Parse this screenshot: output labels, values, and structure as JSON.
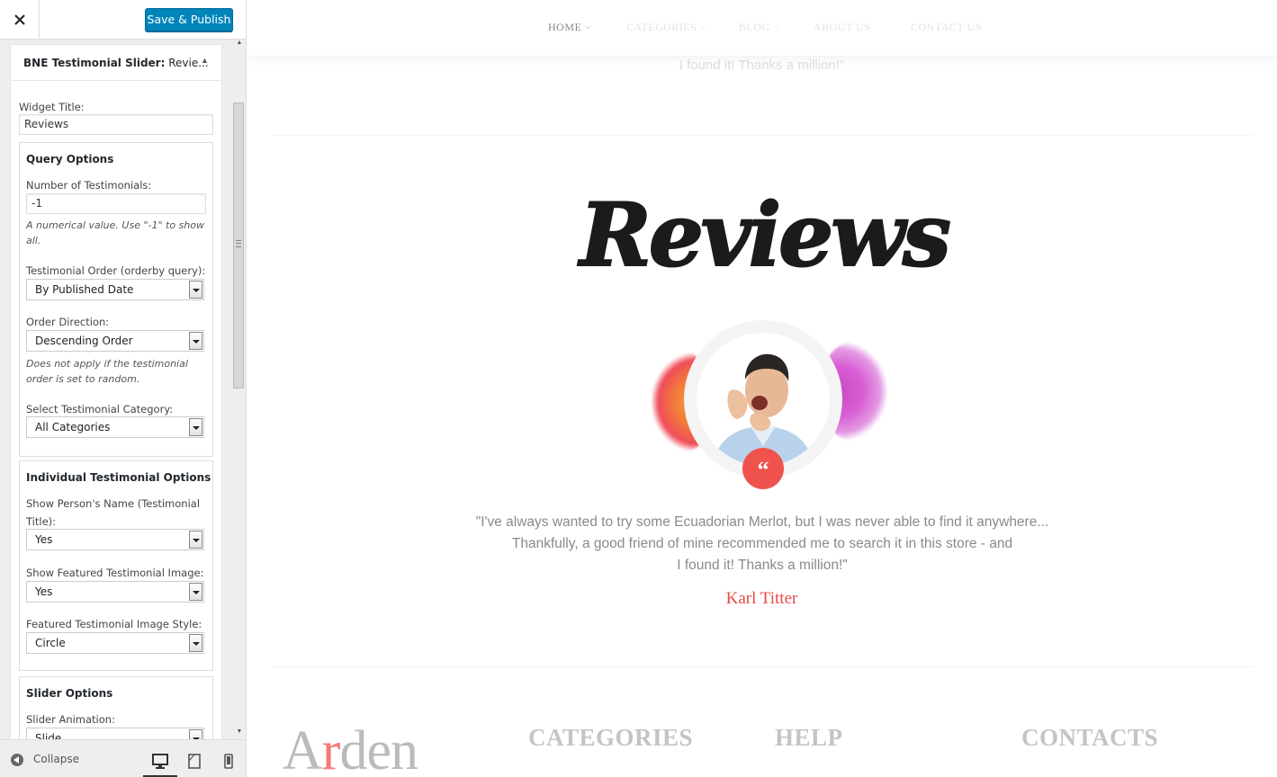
{
  "header": {
    "close_label": "Close",
    "save_label": "Save & Publish",
    "accent": "#0085ba"
  },
  "widget": {
    "title_bold": "BNE Testimonial Slider:",
    "title_instance": " Revie...",
    "widget_title_label": "Widget Title:",
    "widget_title_value": "Reviews",
    "query": {
      "title": "Query Options",
      "count_label": "Number of Testimonials:",
      "count_value": "-1",
      "count_desc": "A numerical value. Use \"-1\" to show all.",
      "order_label": "Testimonial Order (orderby query):",
      "order_value": "By Published Date",
      "direction_label": "Order Direction:",
      "direction_value": "Descending Order",
      "direction_desc": "Does not apply if the testimonial order is set to random.",
      "category_label": "Select Testimonial Category:",
      "category_value": "All Categories"
    },
    "individual": {
      "title": "Individual Testimonial Options",
      "name_label_1": "Show Person's Name (Testimonial",
      "name_label_2": "Title):",
      "name_value": "Yes",
      "image_label": "Show Featured Testimonial Image:",
      "image_value": "Yes",
      "style_label": "Featured Testimonial Image Style:",
      "style_value": "Circle"
    },
    "slider": {
      "title": "Slider Options",
      "animation_label": "Slider Animation:",
      "animation_value": "Slide"
    }
  },
  "footer": {
    "collapse_label": "Collapse",
    "devices": [
      "desktop-icon",
      "tablet-icon",
      "mobile-icon"
    ]
  },
  "preview": {
    "nav": {
      "home": "HOME",
      "categories": "CATEGORIES",
      "blog": "BLOG",
      "about": "ABOUT US",
      "contact": "CONTACT US"
    },
    "prev_quote_tail": "I found it! Thanks a million!\"",
    "heading": "Reviews",
    "quote_mark": "“",
    "testimonial_lines": [
      "\"I've always wanted to try some Ecuadorian Merlot, but I was never able to find it anywhere...",
      "Thankfully, a good friend of mine recommended me to search it in this store - and",
      "I found it! Thanks a million!\""
    ],
    "person_name": "Karl Titter",
    "accent": "#f0524d",
    "footer_logo_first": "A",
    "footer_logo_accent": "r",
    "footer_logo_rest": "den",
    "footer_headings": [
      "CATEGORIES",
      "HELP",
      "CONTACTS"
    ]
  }
}
